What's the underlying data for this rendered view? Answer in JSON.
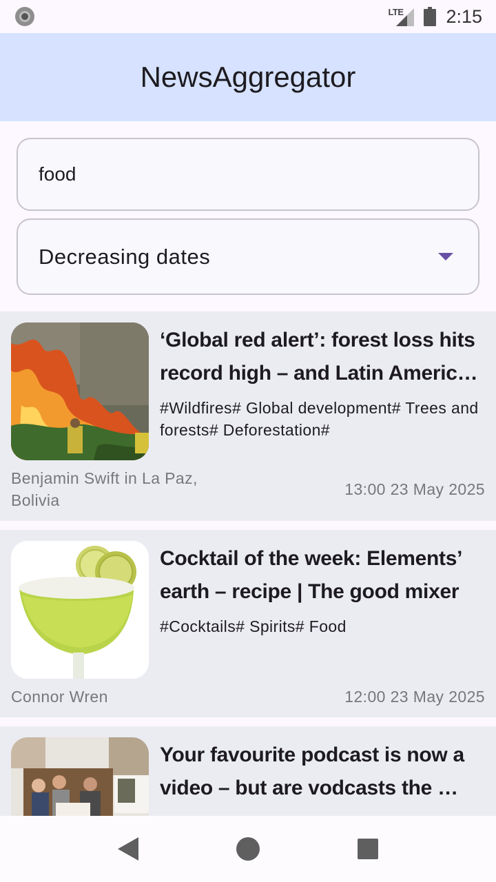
{
  "status_bar": {
    "network": "LTE",
    "time": "2:15"
  },
  "app_bar": {
    "title": "NewsAggregator"
  },
  "search": {
    "value": "food"
  },
  "sort": {
    "selected": "Decreasing dates"
  },
  "articles": [
    {
      "title": "‘Global red alert’: forest loss hits record high – and Latin Americ…",
      "tags": "#Wildfires# Global development# Trees and forests# Deforestation#",
      "author": "Benjamin Swift in La Paz, Bolivia",
      "date": "13:00 23 May 2025"
    },
    {
      "title": "Cocktail of the week: Elements’ earth – recipe | The good mixer",
      "tags": "#Cocktails# Spirits# Food",
      "author": "Connor Wren",
      "date": "12:00 23 May 2025"
    },
    {
      "title": "Your favourite podcast is now a video – but are vodcasts the …"
    }
  ]
}
